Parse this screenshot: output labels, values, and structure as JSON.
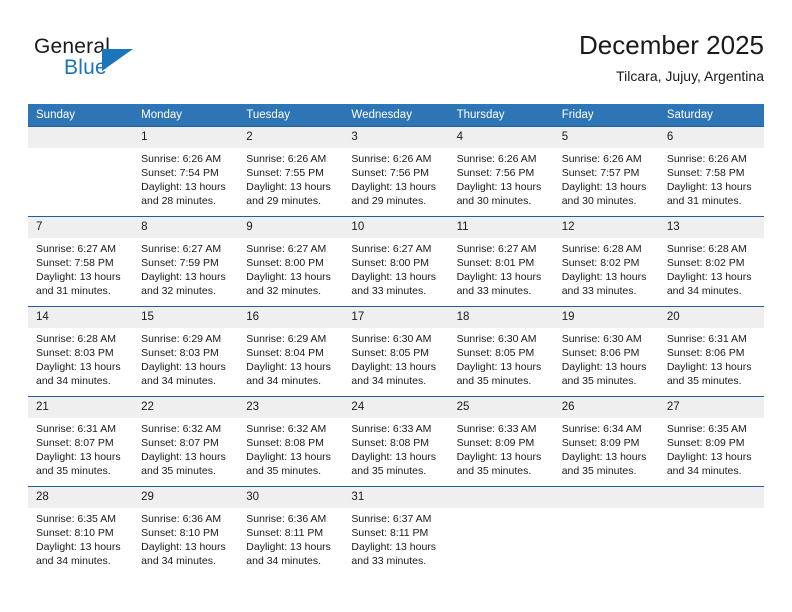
{
  "brand": {
    "name_line1": "General",
    "name_line2": "Blue",
    "logo_icon": "triangle-logo-icon"
  },
  "header": {
    "title": "December 2025",
    "subtitle": "Tilcara, Jujuy, Argentina"
  },
  "colors": {
    "header_blue": "#2e75b6",
    "row_border_blue": "#1f5fa0",
    "daynum_band": "#efefef",
    "brand_blue": "#1b75bb"
  },
  "weekdays": [
    "Sunday",
    "Monday",
    "Tuesday",
    "Wednesday",
    "Thursday",
    "Friday",
    "Saturday"
  ],
  "weeks": [
    [
      {
        "day": "",
        "blank": true,
        "sunrise": "",
        "sunset": "",
        "daylight": ""
      },
      {
        "day": "1",
        "sunrise": "Sunrise: 6:26 AM",
        "sunset": "Sunset: 7:54 PM",
        "daylight": "Daylight: 13 hours and 28 minutes."
      },
      {
        "day": "2",
        "sunrise": "Sunrise: 6:26 AM",
        "sunset": "Sunset: 7:55 PM",
        "daylight": "Daylight: 13 hours and 29 minutes."
      },
      {
        "day": "3",
        "sunrise": "Sunrise: 6:26 AM",
        "sunset": "Sunset: 7:56 PM",
        "daylight": "Daylight: 13 hours and 29 minutes."
      },
      {
        "day": "4",
        "sunrise": "Sunrise: 6:26 AM",
        "sunset": "Sunset: 7:56 PM",
        "daylight": "Daylight: 13 hours and 30 minutes."
      },
      {
        "day": "5",
        "sunrise": "Sunrise: 6:26 AM",
        "sunset": "Sunset: 7:57 PM",
        "daylight": "Daylight: 13 hours and 30 minutes."
      },
      {
        "day": "6",
        "sunrise": "Sunrise: 6:26 AM",
        "sunset": "Sunset: 7:58 PM",
        "daylight": "Daylight: 13 hours and 31 minutes."
      }
    ],
    [
      {
        "day": "7",
        "sunrise": "Sunrise: 6:27 AM",
        "sunset": "Sunset: 7:58 PM",
        "daylight": "Daylight: 13 hours and 31 minutes."
      },
      {
        "day": "8",
        "sunrise": "Sunrise: 6:27 AM",
        "sunset": "Sunset: 7:59 PM",
        "daylight": "Daylight: 13 hours and 32 minutes."
      },
      {
        "day": "9",
        "sunrise": "Sunrise: 6:27 AM",
        "sunset": "Sunset: 8:00 PM",
        "daylight": "Daylight: 13 hours and 32 minutes."
      },
      {
        "day": "10",
        "sunrise": "Sunrise: 6:27 AM",
        "sunset": "Sunset: 8:00 PM",
        "daylight": "Daylight: 13 hours and 33 minutes."
      },
      {
        "day": "11",
        "sunrise": "Sunrise: 6:27 AM",
        "sunset": "Sunset: 8:01 PM",
        "daylight": "Daylight: 13 hours and 33 minutes."
      },
      {
        "day": "12",
        "sunrise": "Sunrise: 6:28 AM",
        "sunset": "Sunset: 8:02 PM",
        "daylight": "Daylight: 13 hours and 33 minutes."
      },
      {
        "day": "13",
        "sunrise": "Sunrise: 6:28 AM",
        "sunset": "Sunset: 8:02 PM",
        "daylight": "Daylight: 13 hours and 34 minutes."
      }
    ],
    [
      {
        "day": "14",
        "sunrise": "Sunrise: 6:28 AM",
        "sunset": "Sunset: 8:03 PM",
        "daylight": "Daylight: 13 hours and 34 minutes."
      },
      {
        "day": "15",
        "sunrise": "Sunrise: 6:29 AM",
        "sunset": "Sunset: 8:03 PM",
        "daylight": "Daylight: 13 hours and 34 minutes."
      },
      {
        "day": "16",
        "sunrise": "Sunrise: 6:29 AM",
        "sunset": "Sunset: 8:04 PM",
        "daylight": "Daylight: 13 hours and 34 minutes."
      },
      {
        "day": "17",
        "sunrise": "Sunrise: 6:30 AM",
        "sunset": "Sunset: 8:05 PM",
        "daylight": "Daylight: 13 hours and 34 minutes."
      },
      {
        "day": "18",
        "sunrise": "Sunrise: 6:30 AM",
        "sunset": "Sunset: 8:05 PM",
        "daylight": "Daylight: 13 hours and 35 minutes."
      },
      {
        "day": "19",
        "sunrise": "Sunrise: 6:30 AM",
        "sunset": "Sunset: 8:06 PM",
        "daylight": "Daylight: 13 hours and 35 minutes."
      },
      {
        "day": "20",
        "sunrise": "Sunrise: 6:31 AM",
        "sunset": "Sunset: 8:06 PM",
        "daylight": "Daylight: 13 hours and 35 minutes."
      }
    ],
    [
      {
        "day": "21",
        "sunrise": "Sunrise: 6:31 AM",
        "sunset": "Sunset: 8:07 PM",
        "daylight": "Daylight: 13 hours and 35 minutes."
      },
      {
        "day": "22",
        "sunrise": "Sunrise: 6:32 AM",
        "sunset": "Sunset: 8:07 PM",
        "daylight": "Daylight: 13 hours and 35 minutes."
      },
      {
        "day": "23",
        "sunrise": "Sunrise: 6:32 AM",
        "sunset": "Sunset: 8:08 PM",
        "daylight": "Daylight: 13 hours and 35 minutes."
      },
      {
        "day": "24",
        "sunrise": "Sunrise: 6:33 AM",
        "sunset": "Sunset: 8:08 PM",
        "daylight": "Daylight: 13 hours and 35 minutes."
      },
      {
        "day": "25",
        "sunrise": "Sunrise: 6:33 AM",
        "sunset": "Sunset: 8:09 PM",
        "daylight": "Daylight: 13 hours and 35 minutes."
      },
      {
        "day": "26",
        "sunrise": "Sunrise: 6:34 AM",
        "sunset": "Sunset: 8:09 PM",
        "daylight": "Daylight: 13 hours and 35 minutes."
      },
      {
        "day": "27",
        "sunrise": "Sunrise: 6:35 AM",
        "sunset": "Sunset: 8:09 PM",
        "daylight": "Daylight: 13 hours and 34 minutes."
      }
    ],
    [
      {
        "day": "28",
        "sunrise": "Sunrise: 6:35 AM",
        "sunset": "Sunset: 8:10 PM",
        "daylight": "Daylight: 13 hours and 34 minutes."
      },
      {
        "day": "29",
        "sunrise": "Sunrise: 6:36 AM",
        "sunset": "Sunset: 8:10 PM",
        "daylight": "Daylight: 13 hours and 34 minutes."
      },
      {
        "day": "30",
        "sunrise": "Sunrise: 6:36 AM",
        "sunset": "Sunset: 8:11 PM",
        "daylight": "Daylight: 13 hours and 34 minutes."
      },
      {
        "day": "31",
        "sunrise": "Sunrise: 6:37 AM",
        "sunset": "Sunset: 8:11 PM",
        "daylight": "Daylight: 13 hours and 33 minutes."
      },
      {
        "day": "",
        "blank": true,
        "sunrise": "",
        "sunset": "",
        "daylight": ""
      },
      {
        "day": "",
        "blank": true,
        "sunrise": "",
        "sunset": "",
        "daylight": ""
      },
      {
        "day": "",
        "blank": true,
        "sunrise": "",
        "sunset": "",
        "daylight": ""
      }
    ]
  ]
}
